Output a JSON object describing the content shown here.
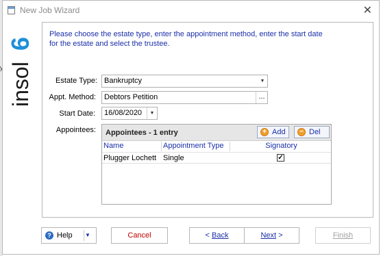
{
  "window": {
    "title": "New Job Wizard"
  },
  "background_text": "y",
  "logo": {
    "text": "insol",
    "mark": "6"
  },
  "instructions": "Please choose the estate type, enter the appointment method, enter the start date for the estate and select the trustee.",
  "form": {
    "estate_type": {
      "label": "Estate Type:",
      "value": "Bankruptcy"
    },
    "appt_method": {
      "label": "Appt. Method:",
      "value": "Debtors Petition",
      "button_label": "..."
    },
    "start_date": {
      "label": "Start Date:",
      "value": "16/08/2020"
    },
    "appointees": {
      "label": "Appointees:"
    }
  },
  "grid": {
    "title": "Appointees - 1 entry",
    "add_label": "Add",
    "del_label": "Del",
    "columns": [
      "Name",
      "Appointment Type",
      "Signatory"
    ],
    "rows": [
      {
        "name": "Plugger Lochett",
        "type": "Single",
        "signatory": true
      }
    ]
  },
  "buttons": {
    "help": "Help",
    "cancel": "Cancel",
    "back_prefix": "< ",
    "back": "Back",
    "next": "Next",
    "next_suffix": " >",
    "finish": "Finish"
  },
  "colors": {
    "instructions": "#1a2fa8",
    "cancel_text": "#c00000",
    "disabled_text": "#a0a0a0",
    "logo_blue": "#1f8fd8"
  }
}
